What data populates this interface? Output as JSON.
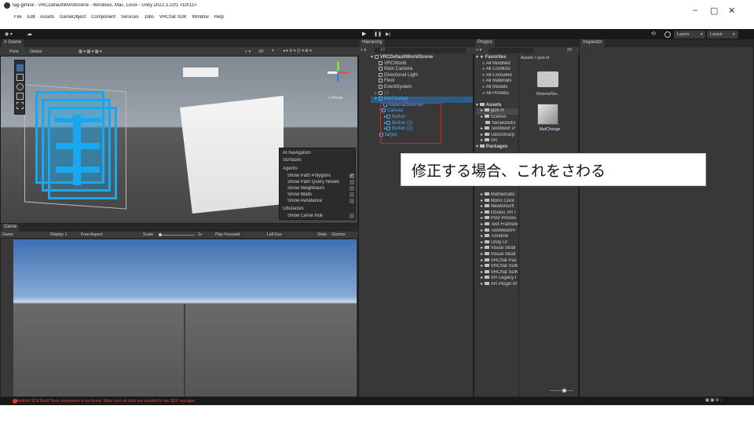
{
  "title_bar": {
    "title": "tag-gimick - VRCDefaultWorldScene - Windows, Mac, Linux - Unity 2022.3.22f1 <DX11>",
    "minimize": "–",
    "maximize": "▢",
    "close": "✕"
  },
  "menu": [
    "File",
    "Edit",
    "Assets",
    "GameObject",
    "Component",
    "Services",
    "Jobs",
    "VRChat SDK",
    "Window",
    "Help"
  ],
  "toolbar": {
    "account": "◉ ▾",
    "cloud": "☁",
    "play": "▶",
    "pause": "❚❚",
    "step": "▶|",
    "history": "⟲",
    "search": "🔍",
    "layers": "Layers",
    "layout": "Layout"
  },
  "scene": {
    "tab": "# Scene",
    "pivot": "Pivot",
    "global": "Global",
    "mode_2d": "2D",
    "persp": "< Persp",
    "nav_overlay": {
      "title": "AI Navigation",
      "surfaces": "Surfaces",
      "agents": "Agents",
      "items": [
        "Show Path Polygons",
        "Show Path Query Nodes",
        "Show Neighbours",
        "Show Walls",
        "Show Avoidance"
      ],
      "obstacles": "Obstacles",
      "hull": "Show Carve Hull"
    }
  },
  "game": {
    "tab": "Game",
    "view": "Game",
    "display": "Display 1",
    "aspect": "Free Aspect",
    "scale_label": "Scale",
    "scale_value": "1x",
    "play_mode": "Play Focused",
    "eye": "Left Eye",
    "stats": "Stats",
    "gizmos": "Gizmos"
  },
  "hierarchy": {
    "tab": "Hierarchy",
    "search": "All",
    "scene": "VRCDefaultWorldScene",
    "items": [
      "VRCWorld",
      "Main Camera",
      "Directional Light",
      "Floor",
      "EventSystem"
    ],
    "ui_item": "UI",
    "mat_change": "MatChange",
    "children": [
      "MaterialSwitcher",
      "Canvas",
      "Button",
      "Button (1)",
      "Button (2)",
      "target"
    ]
  },
  "project": {
    "tab": "Project",
    "favorites": "Favorites",
    "fav_items": [
      "All Modified",
      "All Conflicts",
      "All Excluded",
      "All Materials",
      "All Models",
      "All Prefabs"
    ],
    "assets": "Assets",
    "asset_folders": [
      "jack-H",
      "Scenes",
      "SerializedU",
      "TextMesh P",
      "UdonSharp",
      "XR"
    ],
    "packages": "Packages",
    "packages_list": [
      "Mathematic",
      "Mono Cecil",
      "Newtonsoft",
      "Oculus XR I",
      "Post Proces",
      "Test Framew",
      "TextMeshPr",
      "Timeline",
      "Unity UI",
      "Visual Studi",
      "Visual Studi",
      "VRChat Pac",
      "VRChat SDK",
      "VRChat SDK",
      "XR Legacy I",
      "XR Plugin M"
    ],
    "breadcrumb": "Assets > jack-H",
    "files": [
      "MaterialSw...",
      "MatChange"
    ],
    "count": "23"
  },
  "inspector": {
    "tab": "Inspector"
  },
  "overlay": {
    "text": "修正する場合、これをさわる"
  },
  "status": {
    "message": "Android SDK Build Tools component is not found. Make sure all tools are installed in the SDK manager."
  }
}
